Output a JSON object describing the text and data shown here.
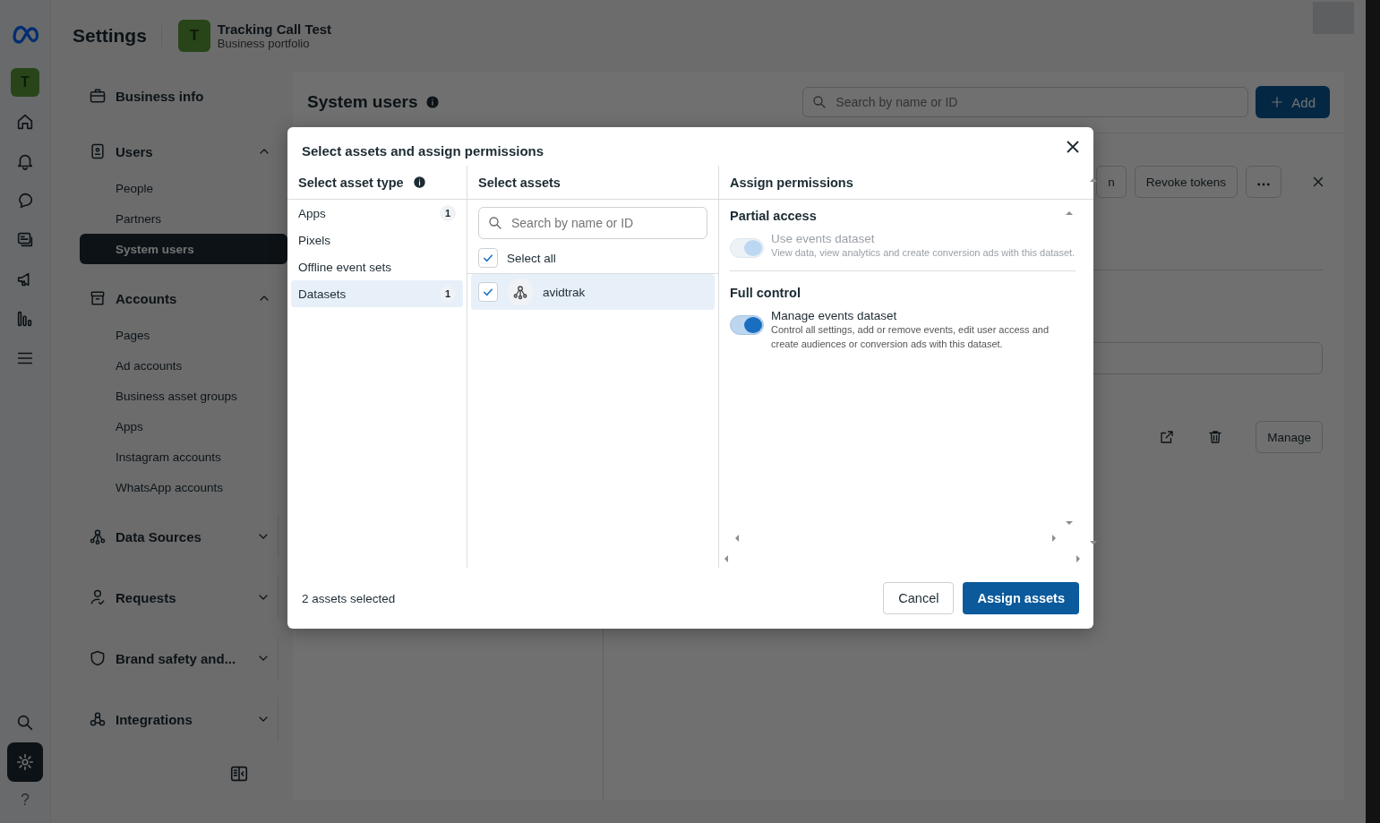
{
  "rail": {
    "avatar": "T",
    "items": [
      {
        "selected": false
      },
      {
        "selected": false
      },
      {
        "selected": false
      },
      {
        "selected": false
      },
      {
        "selected": false
      },
      {
        "selected": false
      },
      {
        "selected": false
      }
    ],
    "bottom": [
      {
        "selected": false
      },
      {
        "selected": true
      },
      {
        "selected": false
      }
    ],
    "help": "?"
  },
  "header": {
    "title": "Settings",
    "portfolio_avatar": "T",
    "portfolio_name": "Tracking Call Test",
    "portfolio_type": "Business portfolio"
  },
  "sidebar": {
    "sections": [
      {
        "label": "Business info"
      },
      {
        "label": "Users",
        "expanded": true,
        "children": [
          {
            "label": "People",
            "selected": false
          },
          {
            "label": "Partners",
            "selected": false
          },
          {
            "label": "System users",
            "selected": true
          }
        ]
      },
      {
        "label": "Accounts",
        "expanded": true,
        "children": [
          {
            "label": "Pages",
            "selected": false
          },
          {
            "label": "Ad accounts",
            "selected": false
          },
          {
            "label": "Business asset groups",
            "selected": false
          },
          {
            "label": "Apps",
            "selected": false
          },
          {
            "label": "Instagram accounts",
            "selected": false
          },
          {
            "label": "WhatsApp accounts",
            "selected": false
          }
        ]
      },
      {
        "label": "Data Sources",
        "expanded": false
      },
      {
        "label": "Requests",
        "expanded": false
      },
      {
        "label": "Brand safety and...",
        "expanded": false
      },
      {
        "label": "Integrations",
        "expanded": false
      }
    ]
  },
  "main": {
    "title": "System users",
    "search": {
      "placeholder": "Search by name or ID"
    },
    "add_button": "Add",
    "detail": {
      "buttons": [
        "n",
        "Revoke tokens"
      ],
      "manage_button": "Manage"
    }
  },
  "modal": {
    "title": "Select assets and assign permissions",
    "asset_types": {
      "heading": "Select asset type",
      "items": [
        {
          "label": "Apps",
          "count": "1",
          "selected": false
        },
        {
          "label": "Pixels",
          "selected": false
        },
        {
          "label": "Offline event sets",
          "selected": false
        },
        {
          "label": "Datasets",
          "count": "1",
          "selected": true
        }
      ]
    },
    "assets": {
      "heading": "Select assets",
      "search": {
        "placeholder": "Search by name or ID"
      },
      "select_all": {
        "label": "Select all",
        "checked": true
      },
      "items": [
        {
          "name": "avidtrak",
          "checked": true,
          "selected": true
        }
      ]
    },
    "permissions": {
      "heading": "Assign permissions",
      "sections": [
        {
          "title": "Partial access",
          "options": [
            {
              "label": "Use events dataset",
              "description": "View data, view analytics and create conversion ads with this dataset.",
              "on": true,
              "disabled": true
            }
          ]
        },
        {
          "title": "Full control",
          "options": [
            {
              "label": "Manage events dataset",
              "description": "Control all settings, add or remove events, edit user access and create audiences or conversion ads with this dataset.",
              "on": true,
              "disabled": false
            }
          ]
        }
      ]
    },
    "footer": {
      "status": "2 assets selected",
      "cancel": "Cancel",
      "confirm": "Assign assets"
    }
  }
}
